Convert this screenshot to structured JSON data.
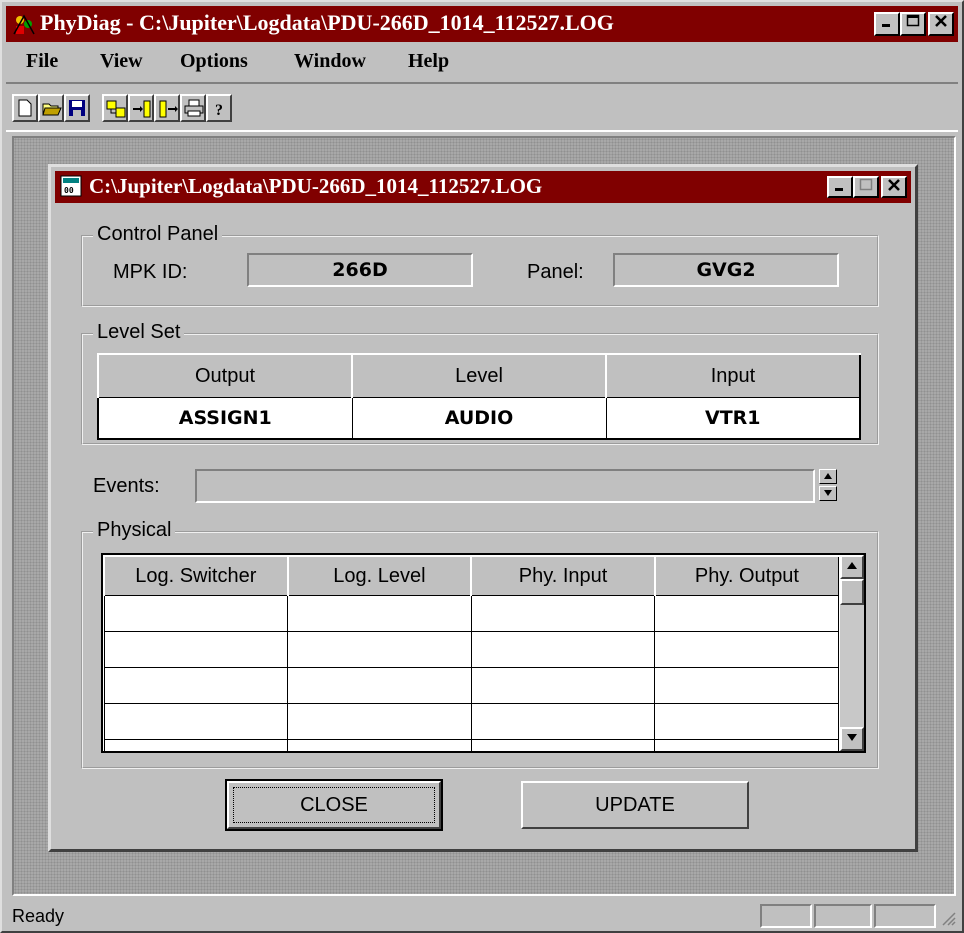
{
  "app": {
    "title": "PhyDiag - C:\\Jupiter\\Logdata\\PDU-266D_1014_112527.LOG"
  },
  "menu": {
    "file": "File",
    "view": "View",
    "options": "Options",
    "window": "Window",
    "help": "Help"
  },
  "toolbar": {
    "buttons": [
      "new-file-icon",
      "open-folder-icon",
      "save-disk-icon",
      "connect-icon",
      "step-in-icon",
      "step-out-icon",
      "print-icon",
      "help-icon"
    ]
  },
  "child": {
    "title": "C:\\Jupiter\\Logdata\\PDU-266D_1014_112527.LOG",
    "control_panel": {
      "label": "Control Panel",
      "mpk_label": "MPK ID:",
      "mpk_value": "266D",
      "panel_label": "Panel:",
      "panel_value": "GVG2"
    },
    "level_set": {
      "label": "Level Set",
      "headers": [
        "Output",
        "Level",
        "Input"
      ],
      "row": [
        "ASSIGN1",
        "AUDIO",
        "VTR1"
      ]
    },
    "events": {
      "label": "Events:",
      "value": ""
    },
    "physical": {
      "label": "Physical",
      "headers": [
        "Log. Switcher",
        "Log. Level",
        "Phy. Input",
        "Phy. Output"
      ]
    },
    "buttons": {
      "close": "CLOSE",
      "update": "UPDATE"
    }
  },
  "status": {
    "text": "Ready"
  },
  "colors": {
    "titlebar": "#800000",
    "face": "#c0c0c0"
  }
}
